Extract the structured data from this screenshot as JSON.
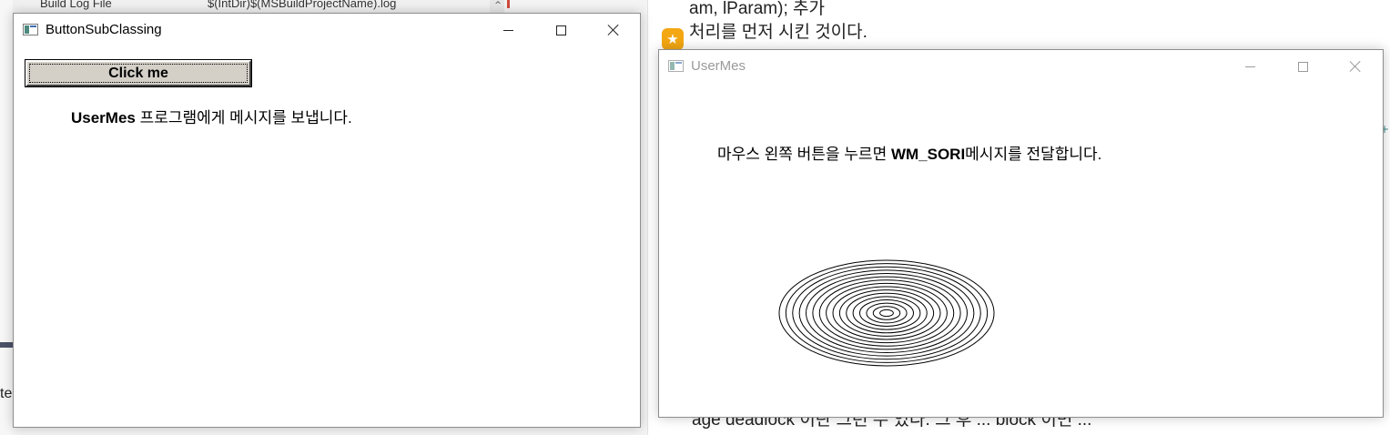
{
  "background": {
    "left_partial_text": "te",
    "property_row": {
      "name": "Build Log File",
      "value": "$(IntDir)$(MSBuildProjectName).log",
      "scroll_glyph": "^"
    },
    "doc_lines": [
      "am, lParam); 추가",
      "처리를 먼저 시킨 것이다.",
      "age deadlock 이란 그런 수 있다. 그 후 ... block 이면 ..."
    ],
    "star_glyph": "★",
    "right_edge_glyph": "+"
  },
  "window1": {
    "title": "ButtonSubClassing",
    "button_label": "Click me",
    "info_bold": "UserMes",
    "info_rest": " 프로그램에게 메시지를 보냅니다."
  },
  "window2": {
    "title": "UserMes",
    "instruction_before": "마우스 왼쪽 버튼을 누르면 ",
    "instruction_bold": "WM_SORI",
    "instruction_after": "메시지를 전달합니다.",
    "ellipse_ring_count": 16
  }
}
